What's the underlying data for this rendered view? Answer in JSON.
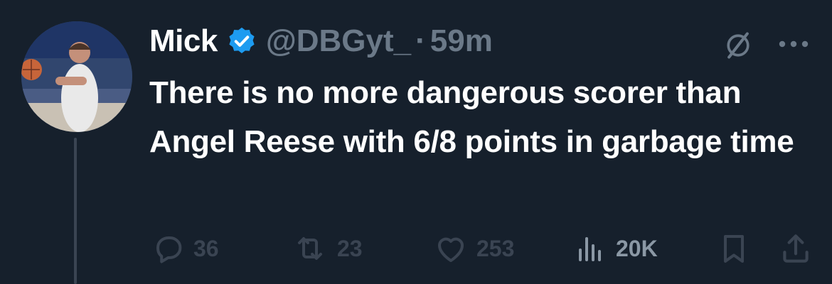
{
  "tweet": {
    "author_name": "Mick",
    "handle": "@DBGyt_",
    "separator": "·",
    "time": "59m",
    "text": "There is no more dangerous scorer than Angel Reese with 6/8 points in garbage time",
    "verified": true
  },
  "actions": {
    "replies": "36",
    "retweets": "23",
    "likes": "253",
    "views": "20K"
  },
  "colors": {
    "background": "#16202c",
    "verified_blue": "#1d9bf0",
    "muted": "#6b7988"
  },
  "icons": [
    "grok-icon",
    "more-icon",
    "reply-icon",
    "retweet-icon",
    "like-icon",
    "views-icon",
    "bookmark-icon",
    "share-icon"
  ]
}
